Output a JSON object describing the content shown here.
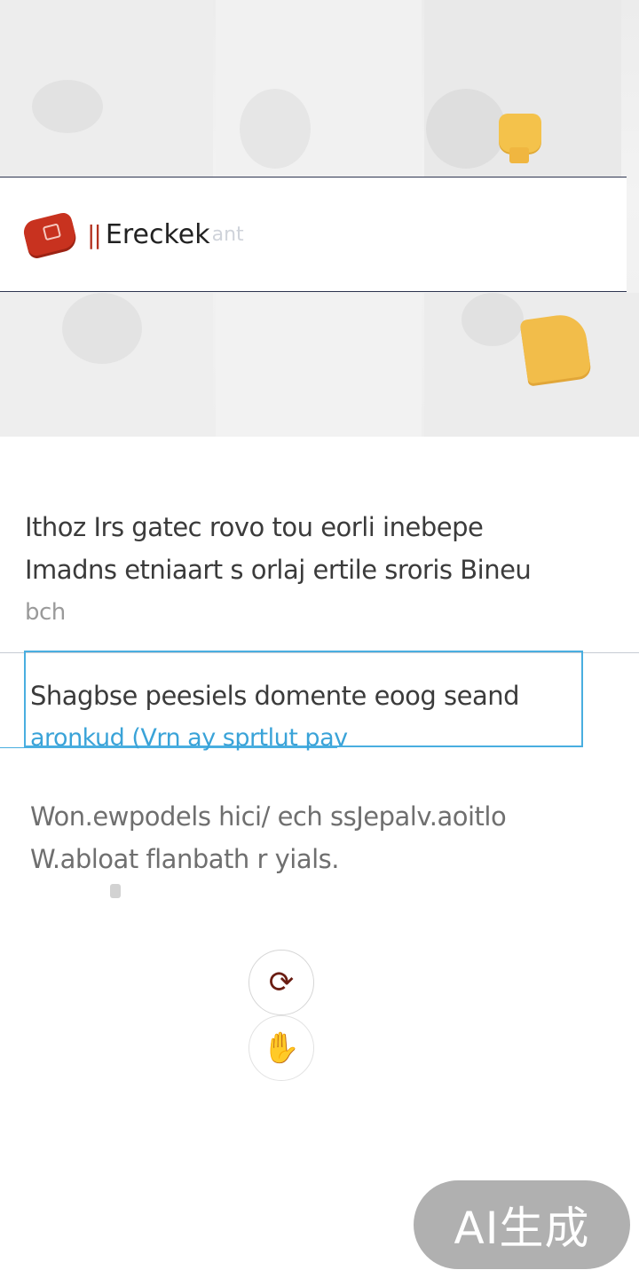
{
  "brand": {
    "name": "Ereckek",
    "name_fade": "ant",
    "divider_mark": "||"
  },
  "content": {
    "paragraph_1_lines": [
      "Ithoz Irs gatec rovo tou eorli inebepe",
      "Imadns etniaart s orlaj ertile sroris Bineu",
      "bch"
    ],
    "highlight_line_1": "Shagbse peesiels domente eoog seand",
    "highlight_link": "aronkud (Vrn ay sprtlut pav",
    "paragraph_3_lines": [
      "Won.ewpodels   hici/ ech ssJepalv.aoitlo",
      "W.abloat flanbath r yials."
    ]
  },
  "icons": {
    "primary_round_button": "rotate-icon",
    "secondary_round_button": "hand-icon",
    "hero_badge_top": "yellow-fist-icon",
    "hero_badge_bottom": "yellow-folder-icon",
    "brand_logo": "red-brand-logo"
  },
  "watermark": {
    "text": "AI生成"
  },
  "colors": {
    "brand_red": "#c8321f",
    "accent_blue": "#49aee0",
    "accent_yellow": "#f2bd4a"
  }
}
